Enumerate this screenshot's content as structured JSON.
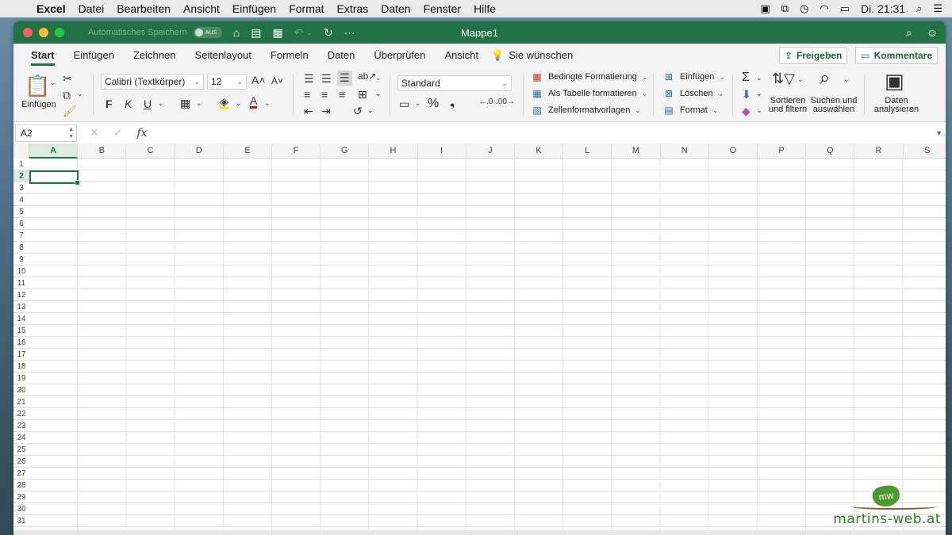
{
  "menubar": {
    "apple_icon": "apple-icon",
    "items": [
      "Excel",
      "Datei",
      "Bearbeiten",
      "Ansicht",
      "Einfügen",
      "Format",
      "Extras",
      "Daten",
      "Fenster",
      "Hilfe"
    ],
    "clock": "Di. 21:31"
  },
  "titlebar": {
    "autosave_label": "Automatisches Speichern",
    "autosave_state": "AUS",
    "title": "Mappe1"
  },
  "tabs": {
    "items": [
      "Start",
      "Einfügen",
      "Zeichnen",
      "Seitenlayout",
      "Formeln",
      "Daten",
      "Überprüfen",
      "Ansicht"
    ],
    "active": "Start",
    "tell_me": "Sie wünschen",
    "share_label": "Freigeben",
    "comments_label": "Kommentare"
  },
  "ribbon": {
    "paste_label": "Einfügen",
    "font_name": "Calibri (Textkörper)",
    "font_size": "12",
    "bold": "F",
    "italic": "K",
    "underline": "U",
    "number_format": "Standard",
    "cond_format": "Bedingte Formatierung",
    "as_table": "Als Tabelle formatieren",
    "cell_styles": "Zellenformatvorlagen",
    "insert": "Einfügen",
    "delete": "Löschen",
    "format": "Format",
    "sort_l1": "Sortieren",
    "sort_l2": "und filtern",
    "find_l1": "Suchen und",
    "find_l2": "auswählen",
    "analyze_l1": "Daten",
    "analyze_l2": "analysieren"
  },
  "formula_bar": {
    "name_box": "A2",
    "fx": "fx",
    "value": ""
  },
  "grid": {
    "columns": [
      "A",
      "B",
      "C",
      "D",
      "E",
      "F",
      "G",
      "H",
      "I",
      "J",
      "K",
      "L",
      "M",
      "N",
      "O",
      "P",
      "Q",
      "R",
      "S"
    ],
    "rows": [
      "1",
      "2",
      "3",
      "4",
      "5",
      "6",
      "7",
      "8",
      "9",
      "10",
      "11",
      "12",
      "13",
      "14",
      "15",
      "16",
      "17",
      "18",
      "19",
      "20",
      "21",
      "22",
      "23",
      "24",
      "25",
      "26",
      "27",
      "28",
      "29",
      "30",
      "31"
    ],
    "selected_column": "A",
    "selected_row": "2",
    "accent": "#217346"
  },
  "watermark": {
    "logo_text": "mw",
    "text": "martins-web.at"
  }
}
